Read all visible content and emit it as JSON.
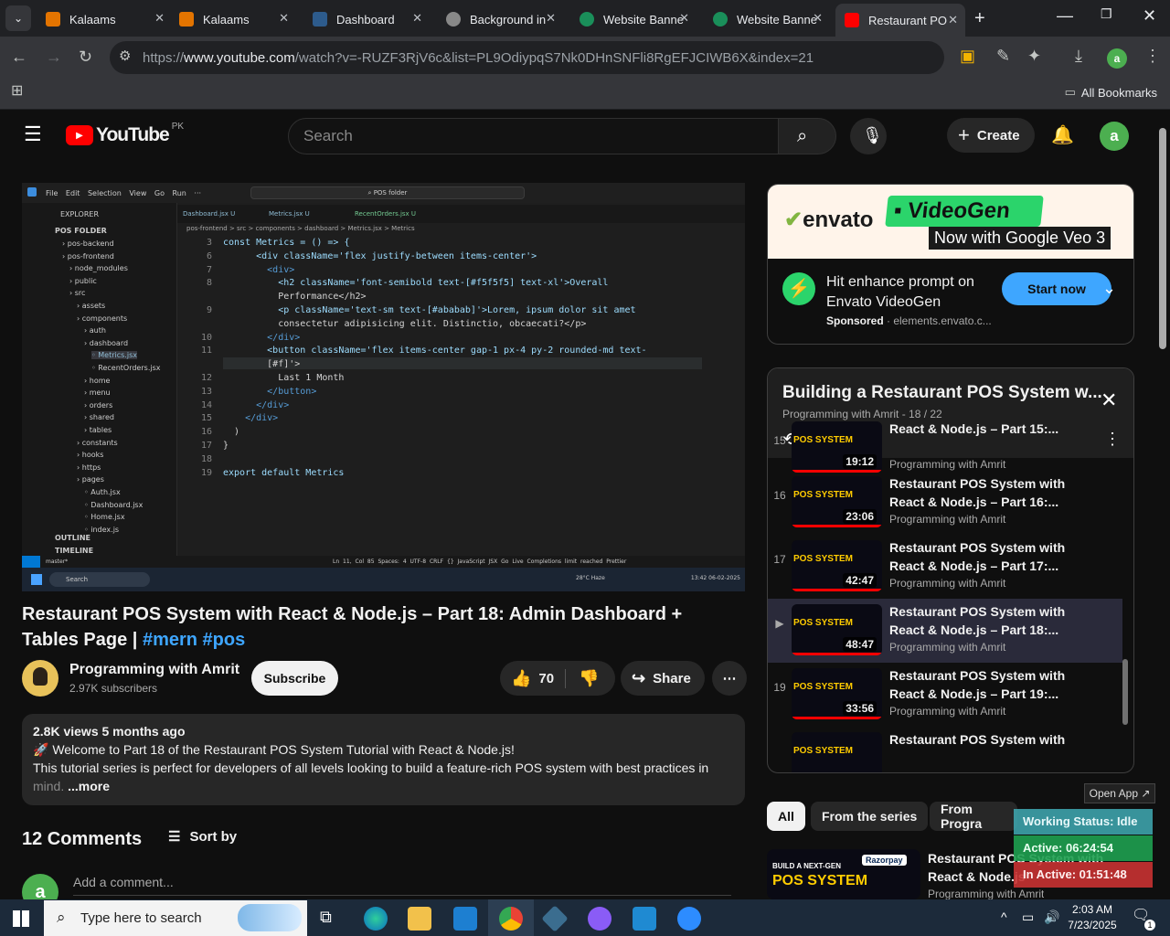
{
  "browser": {
    "tabs": [
      {
        "label": "Kalaams",
        "color": "#e37400"
      },
      {
        "label": "Kalaams",
        "color": "#e37400"
      },
      {
        "label": "Dashboard",
        "color": "#2d5b8c"
      },
      {
        "label": "Background in",
        "color": "#888888"
      },
      {
        "label": "Website Banne",
        "color": "#1a8f5a"
      },
      {
        "label": "Website Banne",
        "color": "#1a8f5a"
      },
      {
        "label": "Restaurant PO",
        "color": "#ff0000"
      }
    ],
    "url_host": "https://www.youtube.com",
    "url_host_prefix": "https://",
    "url_domain": "www.youtube.com",
    "url_path": "/watch?v=-RUZF3RjV6c&list=PL9OdiypqS7Nk0DHnSNFli8RgEFJCIWB6X&index=21",
    "all_bookmarks": "All Bookmarks",
    "profile_initial": "a"
  },
  "yt": {
    "logo_text": "YouTube",
    "country": "PK",
    "search_placeholder": "Search",
    "create_label": "Create",
    "avatar_initial": "a"
  },
  "video_frame": {
    "menu": [
      "File",
      "Edit",
      "Selection",
      "View",
      "Go",
      "Run",
      "···"
    ],
    "search_box": "POS folder",
    "tabs": [
      "Dashboard.jsx U",
      "Metrics.jsx U",
      "RecentOrders.jsx U"
    ],
    "breadcrumb": "pos-frontend > src > components > dashboard > Metrics.jsx > Metrics",
    "explorer_title": "EXPLORER",
    "folder_title": "POS FOLDER",
    "tree": [
      "pos-backend",
      "pos-frontend",
      "node_modules",
      "public",
      "src",
      "assets",
      "components",
      "auth",
      "dashboard",
      "Metrics.jsx",
      "RecentOrders.jsx",
      "home",
      "menu",
      "orders",
      "shared",
      "tables",
      "constants",
      "hooks",
      "https",
      "pages",
      "Auth.jsx",
      "Dashboard.jsx",
      "Home.jsx",
      "index.js"
    ],
    "outline": "OUTLINE",
    "timeline": "TIMELINE",
    "lines": [
      {
        "n": "3",
        "t": "const Metrics = () => {"
      },
      {
        "n": "6",
        "t": "      <div className='flex justify-between items-center'>"
      },
      {
        "n": "7",
        "t": "        <div>"
      },
      {
        "n": "8",
        "t": "          <h2 className='font-semibold text-[#f5f5f5] text-xl'>Overall"
      },
      {
        "n": "",
        "t": "          Performance</h2>"
      },
      {
        "n": "9",
        "t": "          <p className='text-sm text-[#ababab]'>Lorem, ipsum dolor sit amet"
      },
      {
        "n": "",
        "t": "          consectetur adipisicing elit. Distinctio, obcaecati?</p>"
      },
      {
        "n": "10",
        "t": "        </div>"
      },
      {
        "n": "11",
        "t": "        <button className='flex items-center gap-1 px-4 py-2 rounded-md text-"
      },
      {
        "n": "",
        "t": "        [#f]'>"
      },
      {
        "n": "12",
        "t": "          Last 1 Month"
      },
      {
        "n": "13",
        "t": "        </button>"
      },
      {
        "n": "14",
        "t": "      </div>"
      },
      {
        "n": "15",
        "t": "    </div>"
      },
      {
        "n": "16",
        "t": "  )"
      },
      {
        "n": "17",
        "t": "}"
      },
      {
        "n": "18",
        "t": ""
      },
      {
        "n": "19",
        "t": "export default Metrics"
      }
    ],
    "status_left": "master*",
    "status_right": "Ln 11, Col 85   Spaces: 4   UTF-8   CRLF   {} JavaScript JSX   Go Live   Completions limit reached   Prettier",
    "win_search": "Search",
    "weather": "28°C Haze",
    "clock": "13:42 06-02-2025"
  },
  "video": {
    "title": "Restaurant POS System with React & Node.js – Part 18: Admin Dashboard + Tables Page | ",
    "hashtags": "#mern #pos",
    "channel": "Programming with Amrit",
    "subscribers": "2.97K subscribers",
    "subscribe": "Subscribe",
    "likes": "70",
    "share": "Share",
    "views": "2.8K views  5 months ago",
    "desc1": "🚀 Welcome to Part 18 of the Restaurant POS System Tutorial with React & Node.js!",
    "desc2": "This tutorial series is perfect for developers of all levels looking to build a feature-rich POS system with best practices in",
    "desc3": "mind.",
    "more": "...more",
    "comments": "12 Comments",
    "sort": "Sort by",
    "add_comment": "Add a comment..."
  },
  "ad": {
    "brand": "envato",
    "product": "VideoGen",
    "tagline": "Now with Google Veo 3",
    "headline": "Hit enhance prompt on Envato VideoGen",
    "sponsored": "Sponsored",
    "domain": "· elements.envato.c...",
    "cta": "Start now"
  },
  "playlist": {
    "title": "Building a Restaurant POS System w...",
    "meta": "Programming with Amrit - 18 / 22",
    "items": [
      {
        "n": "15",
        "title": "React & Node.js – Part 15:...",
        "dur": "19:12",
        "author": "Programming with Amrit"
      },
      {
        "n": "16",
        "title": "Restaurant POS System with React & Node.js – Part 16:...",
        "dur": "23:06",
        "author": "Programming with Amrit"
      },
      {
        "n": "17",
        "title": "Restaurant POS System with React & Node.js – Part 17:...",
        "dur": "42:47",
        "author": "Programming with Amrit"
      },
      {
        "n": "▶",
        "title": "Restaurant POS System with React & Node.js – Part 18:...",
        "dur": "48:47",
        "author": "Programming with Amrit"
      },
      {
        "n": "19",
        "title": "Restaurant POS System with React & Node.js – Part 19:...",
        "dur": "33:56",
        "author": "Programming with Amrit"
      },
      {
        "n": "",
        "title": "Restaurant POS System with",
        "dur": "",
        "author": ""
      }
    ],
    "thumb_label": "BUILD A NEXT-GEN",
    "thumb_pos": "POS SYSTEM"
  },
  "chips": [
    "All",
    "From the series",
    "From Progra"
  ],
  "related": {
    "title1": "Restaurant POS System with",
    "title2": "React & Node.js",
    "author": "Programming with Amrit",
    "badge": "Razorpay"
  },
  "overlay": {
    "open_app": "Open App ↗",
    "status": "Working Status: Idle",
    "active": "Active: 06:24:54",
    "inactive": "In Active: 01:51:48"
  },
  "taskbar": {
    "search": "Type here to search",
    "time": "2:03 AM",
    "date": "7/23/2025",
    "notif": "1"
  }
}
